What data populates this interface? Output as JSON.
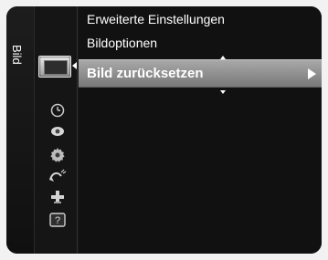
{
  "menu": {
    "label": "Bild"
  },
  "icons": {
    "selected": "picture-icon",
    "items": [
      "clock-icon",
      "camera-icon",
      "gear-icon",
      "satellite-icon",
      "cross-icon",
      "help-icon"
    ]
  },
  "submenu": {
    "item1": "Erweiterte Einstellungen",
    "item2": "Bildoptionen",
    "selected": "Bild zurücksetzen"
  },
  "colors": {
    "background": "#181818",
    "highlight": "#8f8f8f",
    "text": "#ffffff"
  }
}
